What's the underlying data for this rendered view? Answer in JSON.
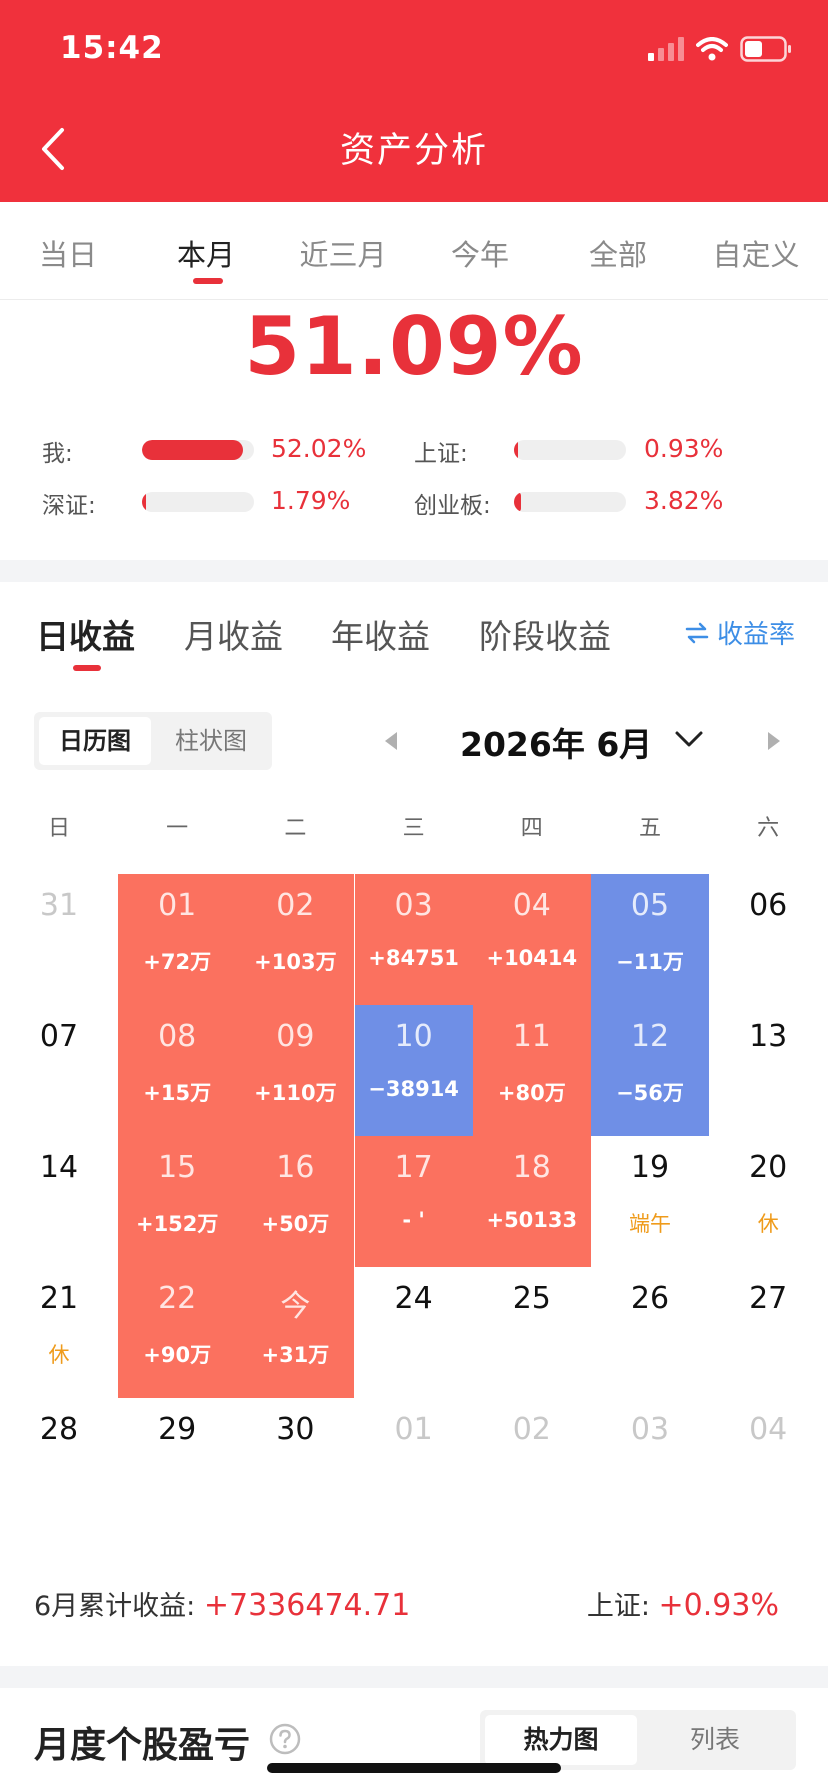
{
  "status_bar": {
    "time": "15:42"
  },
  "header": {
    "title": "资产分析"
  },
  "period_tabs": [
    {
      "label": "当日"
    },
    {
      "label": "本月"
    },
    {
      "label": "近三月"
    },
    {
      "label": "今年"
    },
    {
      "label": "全部"
    },
    {
      "label": "自定义"
    }
  ],
  "summary": {
    "rate": "51.09%",
    "comparisons": [
      {
        "label": "我:",
        "value": "52.02%",
        "fill": 0.9
      },
      {
        "label": "上证:",
        "value": "0.93%",
        "fill": 0.02
      },
      {
        "label": "深证:",
        "value": "1.79%",
        "fill": 0.035
      },
      {
        "label": "创业板:",
        "value": "3.82%",
        "fill": 0.065
      }
    ]
  },
  "income_tabs": [
    {
      "label": "日收益"
    },
    {
      "label": "月收益"
    },
    {
      "label": "年收益"
    },
    {
      "label": "阶段收益"
    }
  ],
  "rate_toggle": {
    "label": "收益率"
  },
  "view_toggle": {
    "calendar": "日历图",
    "bar": "柱状图"
  },
  "month": {
    "title": "2026年 6月"
  },
  "weekdays": [
    "日",
    "一",
    "二",
    "三",
    "四",
    "五",
    "六"
  ],
  "calendar": [
    [
      {
        "day": "31",
        "sub": "",
        "type": "other"
      },
      {
        "day": "01",
        "sub": "+72万",
        "type": "red"
      },
      {
        "day": "02",
        "sub": "+103万",
        "type": "red"
      },
      {
        "day": "03",
        "sub": "+84751",
        "type": "red"
      },
      {
        "day": "04",
        "sub": "+10414",
        "type": "red"
      },
      {
        "day": "05",
        "sub": "−11万",
        "type": "blue"
      },
      {
        "day": "06",
        "sub": "",
        "type": "plain"
      }
    ],
    [
      {
        "day": "07",
        "sub": "",
        "type": "plain"
      },
      {
        "day": "08",
        "sub": "+15万",
        "type": "red"
      },
      {
        "day": "09",
        "sub": "+110万",
        "type": "red"
      },
      {
        "day": "10",
        "sub": "−38914",
        "type": "blue"
      },
      {
        "day": "11",
        "sub": "+80万",
        "type": "red"
      },
      {
        "day": "12",
        "sub": "−56万",
        "type": "blue"
      },
      {
        "day": "13",
        "sub": "",
        "type": "plain"
      }
    ],
    [
      {
        "day": "14",
        "sub": "",
        "type": "plain"
      },
      {
        "day": "15",
        "sub": "+152万",
        "type": "red"
      },
      {
        "day": "16",
        "sub": "+50万",
        "type": "red"
      },
      {
        "day": "17",
        "sub": "-   '",
        "type": "red"
      },
      {
        "day": "18",
        "sub": "+50133",
        "type": "red"
      },
      {
        "day": "19",
        "sub": "端午",
        "type": "plain"
      },
      {
        "day": "20",
        "sub": "休",
        "type": "plain"
      }
    ],
    [
      {
        "day": "21",
        "sub": "休",
        "type": "plain"
      },
      {
        "day": "22",
        "sub": "+90万",
        "type": "red"
      },
      {
        "day": "今",
        "sub": "+31万",
        "type": "red"
      },
      {
        "day": "24",
        "sub": "",
        "type": "plain"
      },
      {
        "day": "25",
        "sub": "",
        "type": "plain"
      },
      {
        "day": "26",
        "sub": "",
        "type": "plain"
      },
      {
        "day": "27",
        "sub": "",
        "type": "plain"
      }
    ],
    [
      {
        "day": "28",
        "sub": "",
        "type": "plain"
      },
      {
        "day": "29",
        "sub": "",
        "type": "plain"
      },
      {
        "day": "30",
        "sub": "",
        "type": "plain"
      },
      {
        "day": "01",
        "sub": "",
        "type": "other"
      },
      {
        "day": "02",
        "sub": "",
        "type": "other"
      },
      {
        "day": "03",
        "sub": "",
        "type": "other"
      },
      {
        "day": "04",
        "sub": "",
        "type": "other"
      }
    ]
  ],
  "month_summary": {
    "label": "6月累计收益:",
    "value": "+7336474.71",
    "index_label": "上证:",
    "index_value": "+0.93%"
  },
  "stock_section": {
    "title": "月度个股盈亏",
    "heatmap_label": "热力图",
    "list_label": "列表"
  },
  "colors": {
    "header": "#f0313c",
    "gain": "#fb715f",
    "loss": "#6f8fe6",
    "accent": "#e8313a",
    "link": "#3d8ee6",
    "holiday": "#ef9b1b"
  }
}
